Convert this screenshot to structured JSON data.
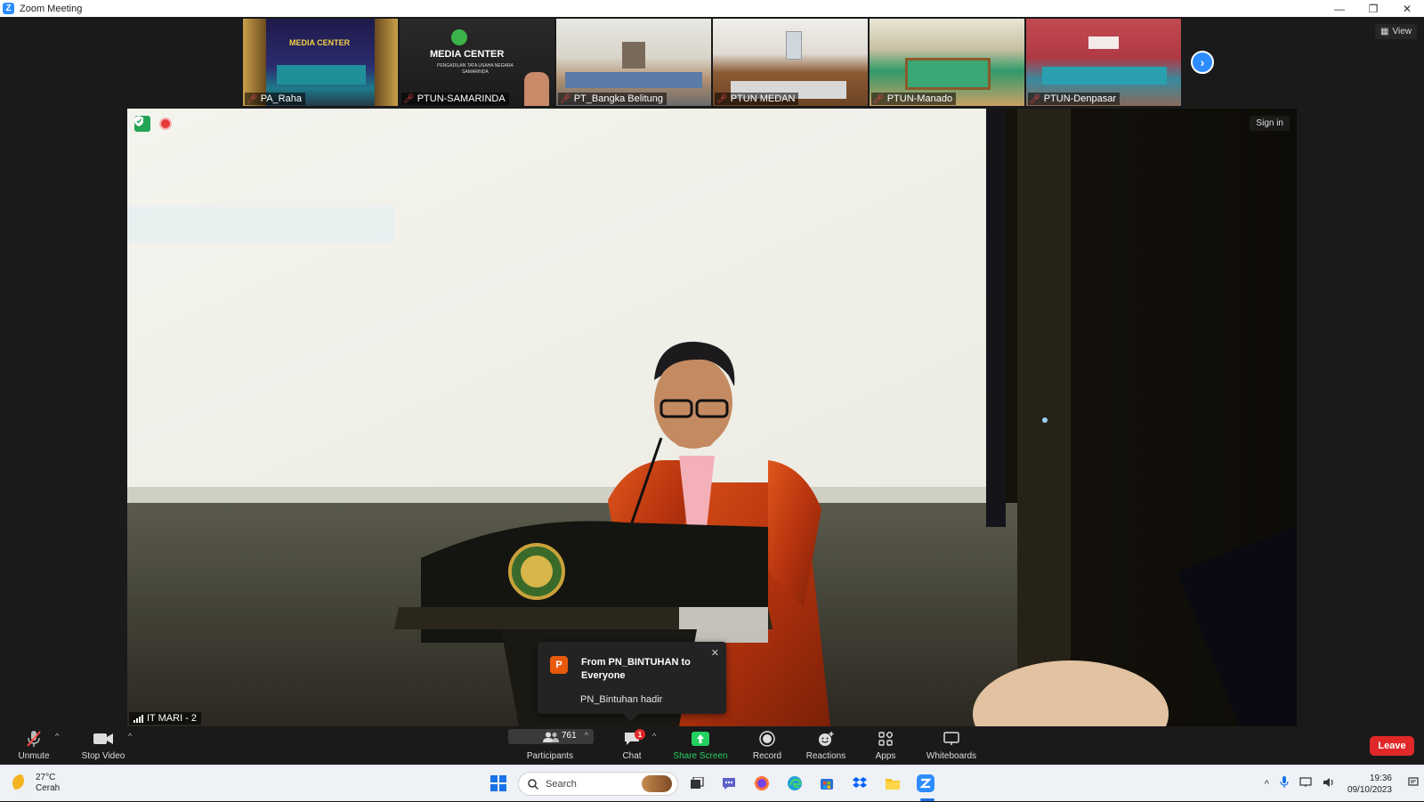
{
  "window": {
    "title": "Zoom Meeting",
    "logo_letter": "Z"
  },
  "window_controls": {
    "minimize": "—",
    "restore": "❐",
    "close": "✕"
  },
  "gallery": {
    "view_label": "View",
    "thumbnails": [
      {
        "name": "PA_Raha",
        "muted": true
      },
      {
        "name": "PTUN-SAMARINDA",
        "muted": true
      },
      {
        "name": "PT_Bangka Belitung",
        "muted": true
      },
      {
        "name": "PTUN MEDAN",
        "muted": true
      },
      {
        "name": "PTUN-Manado",
        "muted": true
      },
      {
        "name": "PTUN-Denpasar",
        "muted": true
      }
    ],
    "thumb_texts": {
      "raha_banner": "MEDIA CENTER",
      "samarinda_banner": "MEDIA CENTER",
      "samarinda_sub": "PENGADILAN TATA USAHA NEGARA SAMARINDA"
    }
  },
  "main_video": {
    "speaker_name": "IT MARI - 2",
    "sign_in_label": "Sign in"
  },
  "chat_notification": {
    "avatar_letter": "P",
    "from": "From PN_BINTUHAN to Everyone",
    "message": "PN_Bintuhan hadir"
  },
  "toolbar": {
    "unmute_label": "Unmute",
    "stop_video_label": "Stop Video",
    "participants_label": "Participants",
    "participants_count": "761",
    "chat_label": "Chat",
    "chat_badge": "1",
    "share_screen_label": "Share Screen",
    "record_label": "Record",
    "reactions_label": "Reactions",
    "apps_label": "Apps",
    "whiteboards_label": "Whiteboards",
    "leave_label": "Leave"
  },
  "taskbar": {
    "weather_temp": "27°C",
    "weather_desc": "Cerah",
    "search_placeholder": "Search",
    "time": "19:36",
    "date": "09/10/2023"
  },
  "colors": {
    "zoom_blue": "#2d8cff",
    "leave_red": "#e02828",
    "share_green": "#23d160"
  }
}
